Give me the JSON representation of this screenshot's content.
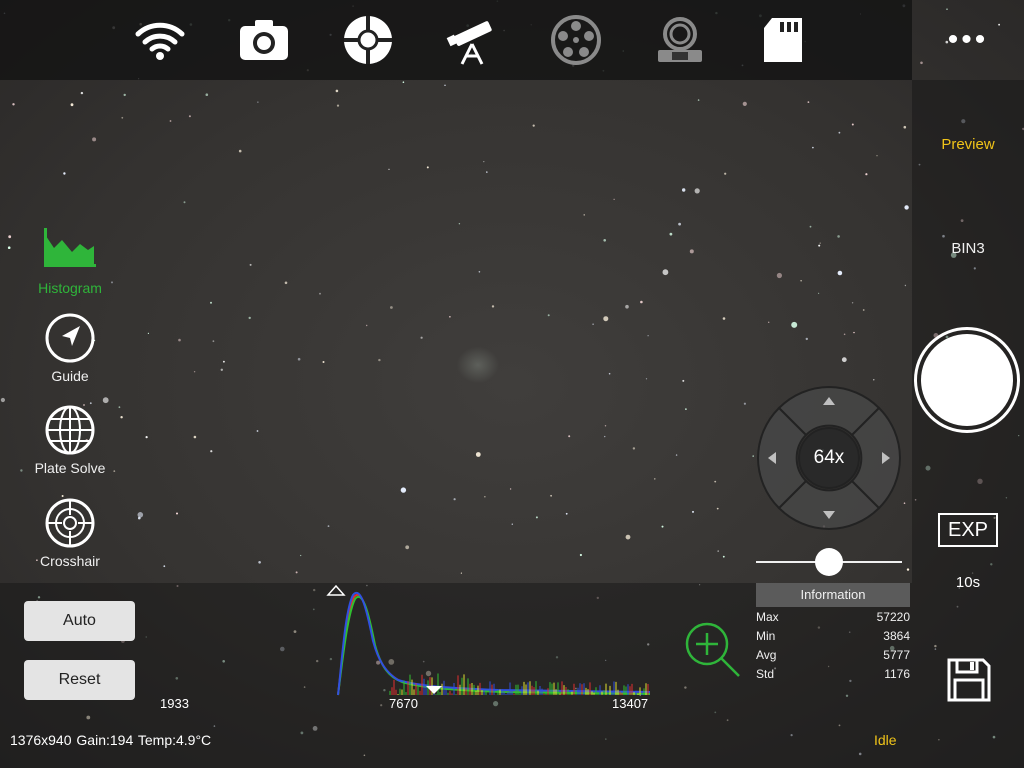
{
  "toolbar": {
    "icons": [
      "wifi-icon",
      "camera-icon",
      "focus-crosshair-icon",
      "telescope-icon",
      "filter-wheel-icon",
      "focuser-icon",
      "sd-card-icon"
    ],
    "more_label": "•••"
  },
  "right_panel": {
    "mode_label": "Preview",
    "binning_label": "BIN3",
    "exp_button_label": "EXP",
    "exposure_value": "10s"
  },
  "left_panel": {
    "tools": [
      {
        "label": "Histogram",
        "icon": "histogram-icon",
        "active": true
      },
      {
        "label": "Guide",
        "icon": "guide-arrow-icon",
        "active": false
      },
      {
        "label": "Plate Solve",
        "icon": "globe-icon",
        "active": false
      },
      {
        "label": "Crosshair",
        "icon": "crosshair-icon",
        "active": false
      }
    ]
  },
  "navigator": {
    "zoom_label": "64x",
    "zoom_slider_fraction": 0.5
  },
  "histogram": {
    "auto_label": "Auto",
    "reset_label": "Reset",
    "min_label": "1933",
    "mid_label": "7670",
    "max_label": "13407"
  },
  "information": {
    "title": "Information",
    "rows": [
      {
        "key": "Max",
        "value": "57220"
      },
      {
        "key": "Min",
        "value": "3864"
      },
      {
        "key": "Avg",
        "value": "5777"
      },
      {
        "key": "Std",
        "value": "1176"
      }
    ]
  },
  "status": {
    "resolution": "1376x940",
    "gain": "Gain:194",
    "temp": "Temp:4.9°C",
    "state": "Idle"
  },
  "colors": {
    "accent_yellow": "#f0c419",
    "accent_green": "#2fb53a"
  }
}
